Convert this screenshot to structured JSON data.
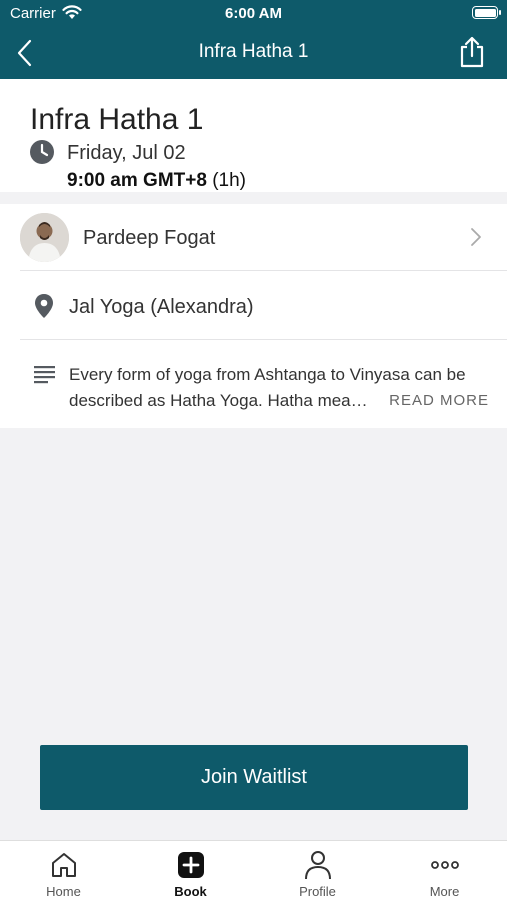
{
  "status_bar": {
    "carrier": "Carrier",
    "time": "6:00 AM"
  },
  "nav": {
    "title": "Infra Hatha 1"
  },
  "class_info": {
    "title": "Infra Hatha 1",
    "date": "Friday, Jul 02",
    "time": "9:00 am GMT+8",
    "duration": "(1h)"
  },
  "instructor": {
    "name": "Pardeep Fogat"
  },
  "location": {
    "name": "Jal Yoga (Alexandra)"
  },
  "description": {
    "line1": "Every form of yoga from Ashtanga to Vinyasa can be",
    "line2": "described as Hatha Yoga. Hatha mea…",
    "read_more": "READ MORE"
  },
  "action": {
    "join_label": "Join Waitlist"
  },
  "colors": {
    "brand": "#0e5a6a"
  },
  "tabs": [
    {
      "label": "Home",
      "icon": "home-icon",
      "active": false
    },
    {
      "label": "Book",
      "icon": "plus-square-icon",
      "active": true
    },
    {
      "label": "Profile",
      "icon": "person-icon",
      "active": false
    },
    {
      "label": "More",
      "icon": "more-dots-icon",
      "active": false
    }
  ]
}
